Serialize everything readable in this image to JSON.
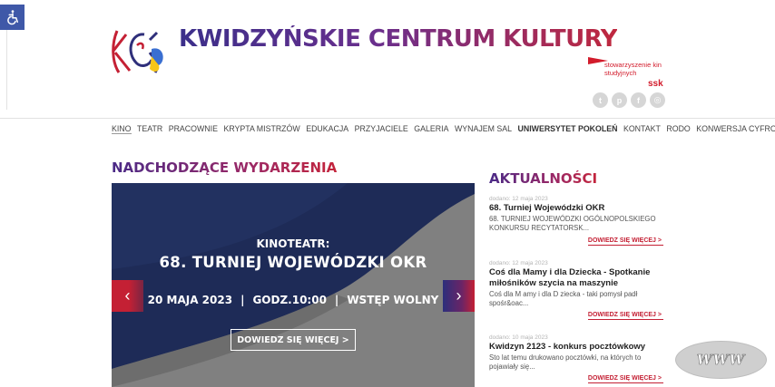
{
  "site": {
    "title": "KWIDZYŃSKIE CENTRUM KULTURY",
    "partner_text": "stowarzyszenie kin studyjnych",
    "partner_mark": "ssk"
  },
  "accessibility": {
    "icon": "wheelchair-icon"
  },
  "socials": [
    {
      "name": "twitter",
      "glyph": "t"
    },
    {
      "name": "pinterest",
      "glyph": "p"
    },
    {
      "name": "facebook",
      "glyph": "f"
    },
    {
      "name": "instagram",
      "glyph": "◎"
    }
  ],
  "nav": [
    {
      "label": "KINO",
      "bold": false,
      "active": true
    },
    {
      "label": "TEATR",
      "bold": false,
      "active": false
    },
    {
      "label": "PRACOWNIE",
      "bold": false,
      "active": false
    },
    {
      "label": "KRYPTA MISTRZÓW",
      "bold": false,
      "active": false
    },
    {
      "label": "EDUKACJA",
      "bold": false,
      "active": false
    },
    {
      "label": "PRZYJACIELE",
      "bold": false,
      "active": false
    },
    {
      "label": "GALERIA",
      "bold": false,
      "active": false
    },
    {
      "label": "WYNAJEM SAL",
      "bold": false,
      "active": false
    },
    {
      "label": "UNIWERSYTET POKOLEŃ",
      "bold": true,
      "active": false
    },
    {
      "label": "KONTAKT",
      "bold": false,
      "active": false
    },
    {
      "label": "RODO",
      "bold": false,
      "active": false
    },
    {
      "label": "KONWERSJA CYFROWA",
      "bold": false,
      "active": false
    }
  ],
  "events": {
    "heading": "NADCHODZĄCE WYDARZENIA",
    "slide": {
      "subtitle": "KINOTEATR:",
      "title": "68. TURNIEJ WOJEWÓDZKI OKR",
      "date": "20 MAJA 2023",
      "time": "GODZ.10:00",
      "entry": "WSTĘP WOLNY",
      "separator": "|",
      "button": "DOWIEDZ SIĘ WIĘCEJ >"
    },
    "prev_glyph": "‹",
    "next_glyph": "›"
  },
  "news": {
    "heading": "AKTUALNOŚCI",
    "items": [
      {
        "date": "dodano: 12 maja 2023",
        "title": "68. Turniej Wojewódzki OKR",
        "excerpt": "68. TURNIEJ WOJEWÓDZKI OGÓLNOPOLSKIEGO KONKURSU RECYTATORSK...",
        "more": "DOWIEDZ SIĘ WIĘCEJ >"
      },
      {
        "date": "dodano: 12 maja 2023",
        "title": "Coś dla Mamy i dla Dziecka - Spotkanie miłośników szycia na maszynie",
        "excerpt": "Coś dla M amy i dla D ziecka - taki pomysł padł spośr&oac...",
        "more": "DOWIEDZ SIĘ WIĘCEJ >"
      },
      {
        "date": "dodano: 10 maja 2023",
        "title": "Kwidzyn 2123 - konkurs pocztówkowy",
        "excerpt": "Sto lat temu drukowano pocztówki, na których to pojawiały się...",
        "more": "DOWIEDZ SIĘ WIĘCEJ >"
      }
    ]
  },
  "badge": {
    "text": "WWW"
  },
  "colors": {
    "brand_purple": "#3b2f8a",
    "brand_red": "#c42034",
    "a11y_blue": "#3f58a8"
  }
}
